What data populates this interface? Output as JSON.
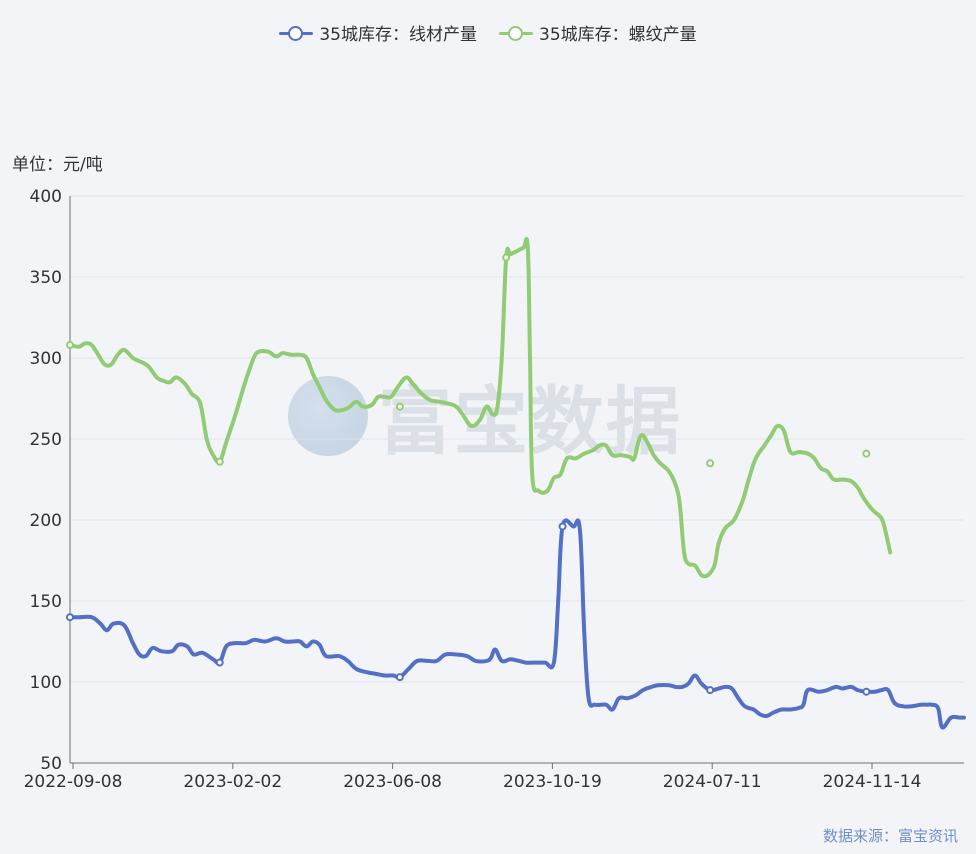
{
  "legend": [
    {
      "name": "35城库存：线材产量",
      "color": "#5470c6"
    },
    {
      "name": "35城库存：螺纹产量",
      "color": "#91cc75"
    }
  ],
  "unit_label": "单位：元/吨",
  "source_label": "数据来源：富宝资讯",
  "watermark": "富宝数据",
  "chart_data": {
    "type": "line",
    "xlabel": "",
    "ylabel": "单位：元/吨",
    "ylim": [
      50,
      400
    ],
    "yticks": [
      50,
      100,
      150,
      200,
      250,
      300,
      350,
      400
    ],
    "xticks": [
      "2022-09-08",
      "2023-02-02",
      "2023-06-08",
      "2023-10-19",
      "2024-07-11",
      "2024-11-14"
    ],
    "grid": true,
    "legend_position": "top-center",
    "series": [
      {
        "name": "35城库存：线材产量",
        "color": "#5470c6",
        "points": [
          [
            0,
            140
          ],
          [
            8,
            140
          ],
          [
            20,
            140
          ],
          [
            28,
            136
          ],
          [
            34,
            132
          ],
          [
            40,
            136
          ],
          [
            50,
            135
          ],
          [
            58,
            124
          ],
          [
            64,
            117
          ],
          [
            70,
            116
          ],
          [
            76,
            121
          ],
          [
            84,
            119
          ],
          [
            94,
            119
          ],
          [
            100,
            123
          ],
          [
            108,
            122
          ],
          [
            114,
            117
          ],
          [
            122,
            118
          ],
          [
            132,
            114
          ],
          [
            138,
            112
          ],
          [
            144,
            122
          ],
          [
            152,
            124
          ],
          [
            162,
            124
          ],
          [
            170,
            126
          ],
          [
            180,
            125
          ],
          [
            190,
            127
          ],
          [
            198,
            125
          ],
          [
            206,
            125
          ],
          [
            212,
            125
          ],
          [
            218,
            122
          ],
          [
            224,
            125
          ],
          [
            230,
            123
          ],
          [
            236,
            116
          ],
          [
            248,
            116
          ],
          [
            256,
            113
          ],
          [
            264,
            108
          ],
          [
            274,
            106
          ],
          [
            282,
            105
          ],
          [
            290,
            104
          ],
          [
            298,
            104
          ],
          [
            304,
            103
          ],
          [
            312,
            108
          ],
          [
            320,
            113
          ],
          [
            330,
            113
          ],
          [
            338,
            113
          ],
          [
            346,
            117
          ],
          [
            356,
            117
          ],
          [
            366,
            116
          ],
          [
            374,
            113
          ],
          [
            384,
            113
          ],
          [
            388,
            115
          ],
          [
            392,
            120
          ],
          [
            398,
            113
          ],
          [
            406,
            114
          ],
          [
            414,
            113
          ],
          [
            420,
            112
          ],
          [
            430,
            112
          ],
          [
            438,
            112
          ],
          [
            446,
            112
          ],
          [
            450,
            150
          ],
          [
            454,
            196
          ],
          [
            464,
            196
          ],
          [
            470,
            194
          ],
          [
            474,
            130
          ],
          [
            478,
            90
          ],
          [
            484,
            86
          ],
          [
            494,
            86
          ],
          [
            500,
            83
          ],
          [
            506,
            90
          ],
          [
            514,
            90
          ],
          [
            522,
            92
          ],
          [
            528,
            95
          ],
          [
            536,
            97
          ],
          [
            542,
            98
          ],
          [
            552,
            98
          ],
          [
            558,
            97
          ],
          [
            564,
            97
          ],
          [
            570,
            99
          ],
          [
            576,
            104
          ],
          [
            582,
            99
          ],
          [
            590,
            95
          ],
          [
            598,
            96
          ],
          [
            604,
            97
          ],
          [
            610,
            96
          ],
          [
            616,
            90
          ],
          [
            622,
            85
          ],
          [
            630,
            83
          ],
          [
            636,
            80
          ],
          [
            642,
            79
          ],
          [
            648,
            81
          ],
          [
            656,
            83
          ],
          [
            664,
            83
          ],
          [
            672,
            84
          ],
          [
            676,
            86
          ],
          [
            680,
            95
          ],
          [
            690,
            94
          ],
          [
            698,
            95
          ],
          [
            706,
            97
          ],
          [
            712,
            96
          ],
          [
            720,
            97
          ],
          [
            726,
            95
          ],
          [
            734,
            94
          ],
          [
            742,
            94
          ],
          [
            748,
            95
          ],
          [
            754,
            95
          ],
          [
            760,
            87
          ],
          [
            768,
            85
          ],
          [
            776,
            85
          ],
          [
            784,
            86
          ],
          [
            790,
            86
          ],
          [
            794,
            86
          ],
          [
            800,
            84
          ],
          [
            804,
            72
          ],
          [
            812,
            78
          ],
          [
            820,
            78
          ],
          [
            824,
            78
          ]
        ]
      },
      {
        "name": "35城库存：螺纹产量",
        "color": "#91cc75",
        "points": [
          [
            0,
            308
          ],
          [
            8,
            307
          ],
          [
            14,
            309
          ],
          [
            20,
            308
          ],
          [
            26,
            302
          ],
          [
            32,
            296
          ],
          [
            38,
            296
          ],
          [
            44,
            302
          ],
          [
            50,
            305
          ],
          [
            58,
            300
          ],
          [
            64,
            298
          ],
          [
            72,
            295
          ],
          [
            80,
            288
          ],
          [
            86,
            286
          ],
          [
            92,
            285
          ],
          [
            98,
            288
          ],
          [
            106,
            284
          ],
          [
            112,
            278
          ],
          [
            120,
            272
          ],
          [
            126,
            250
          ],
          [
            132,
            240
          ],
          [
            138,
            236
          ],
          [
            144,
            248
          ],
          [
            152,
            264
          ],
          [
            160,
            282
          ],
          [
            166,
            294
          ],
          [
            172,
            303
          ],
          [
            182,
            304
          ],
          [
            190,
            301
          ],
          [
            196,
            303
          ],
          [
            204,
            302
          ],
          [
            212,
            302
          ],
          [
            218,
            300
          ],
          [
            224,
            290
          ],
          [
            230,
            282
          ],
          [
            236,
            274
          ],
          [
            244,
            268
          ],
          [
            252,
            268
          ],
          [
            258,
            270
          ],
          [
            264,
            273
          ],
          [
            270,
            270
          ],
          [
            278,
            271
          ],
          [
            284,
            276
          ],
          [
            290,
            276
          ],
          [
            296,
            276
          ],
          [
            302,
            282
          ],
          [
            310,
            288
          ],
          [
            316,
            284
          ],
          [
            324,
            278
          ],
          [
            332,
            274
          ],
          [
            340,
            273
          ],
          [
            348,
            272
          ],
          [
            356,
            270
          ],
          [
            362,
            265
          ],
          [
            370,
            258
          ],
          [
            378,
            262
          ],
          [
            384,
            270
          ],
          [
            390,
            265
          ],
          [
            394,
            270
          ],
          [
            398,
            300
          ],
          [
            402,
            362
          ],
          [
            406,
            364
          ],
          [
            412,
            366
          ],
          [
            418,
            368
          ],
          [
            422,
            368
          ],
          [
            424,
            300
          ],
          [
            426,
            228
          ],
          [
            432,
            218
          ],
          [
            440,
            218
          ],
          [
            446,
            226
          ],
          [
            452,
            228
          ],
          [
            458,
            238
          ],
          [
            466,
            238
          ],
          [
            474,
            241
          ],
          [
            482,
            243
          ],
          [
            488,
            246
          ],
          [
            494,
            246
          ],
          [
            500,
            240
          ],
          [
            508,
            240
          ],
          [
            516,
            239
          ],
          [
            520,
            238
          ],
          [
            526,
            252
          ],
          [
            532,
            248
          ],
          [
            538,
            240
          ],
          [
            544,
            235
          ],
          [
            552,
            230
          ],
          [
            558,
            222
          ],
          [
            562,
            210
          ],
          [
            566,
            180
          ],
          [
            570,
            173
          ],
          [
            576,
            172
          ],
          [
            582,
            166
          ],
          [
            588,
            166
          ],
          [
            594,
            172
          ],
          [
            598,
            186
          ],
          [
            604,
            195
          ],
          [
            612,
            200
          ],
          [
            620,
            212
          ],
          [
            626,
            226
          ],
          [
            632,
            238
          ],
          [
            640,
            246
          ],
          [
            646,
            252
          ],
          [
            652,
            258
          ],
          [
            658,
            255
          ],
          [
            664,
            242
          ],
          [
            672,
            242
          ],
          [
            680,
            241
          ],
          [
            686,
            238
          ],
          [
            692,
            232
          ],
          [
            698,
            230
          ],
          [
            704,
            225
          ],
          [
            712,
            225
          ],
          [
            720,
            224
          ],
          [
            726,
            220
          ],
          [
            732,
            213
          ],
          [
            740,
            206
          ],
          [
            748,
            201
          ],
          [
            752,
            192
          ],
          [
            756,
            180
          ]
        ]
      }
    ],
    "marked_points": [
      {
        "series": 0,
        "points": [
          [
            0,
            140
          ],
          [
            138,
            112
          ],
          [
            304,
            103
          ],
          [
            454,
            196
          ],
          [
            590,
            95
          ],
          [
            734,
            94
          ]
        ]
      },
      {
        "series": 1,
        "points": [
          [
            0,
            308
          ],
          [
            138,
            236
          ],
          [
            304,
            270
          ],
          [
            402,
            362
          ],
          [
            590,
            235
          ],
          [
            734,
            241
          ]
        ]
      }
    ],
    "x_range": [
      0,
      824
    ]
  }
}
